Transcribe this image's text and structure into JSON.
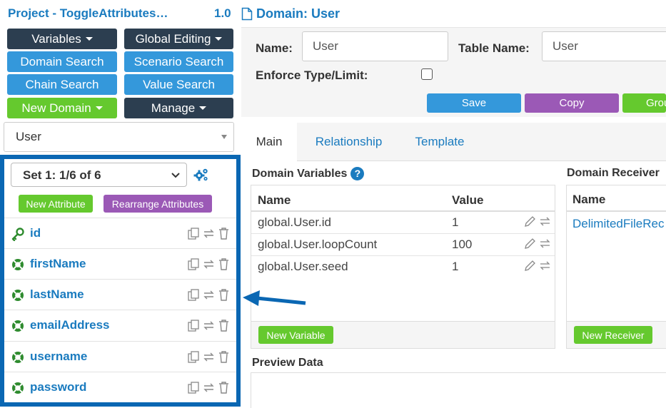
{
  "project": {
    "title": "Project - ToggleAttributes…",
    "version": "1.0"
  },
  "menu": {
    "variables": "Variables",
    "global_editing": "Global Editing",
    "domain_search": "Domain Search",
    "scenario_search": "Scenario Search",
    "chain_search": "Chain Search",
    "value_search": "Value Search",
    "new_domain": "New Domain",
    "manage": "Manage"
  },
  "domain_select": {
    "value": "User"
  },
  "attribute_set": {
    "value": "Set 1: 1/6 of 6"
  },
  "attribute_buttons": {
    "new_attribute": "New Attribute",
    "rearrange": "Rearrange Attributes"
  },
  "attributes": [
    {
      "label": "id",
      "icon": "key-icon"
    },
    {
      "label": "firstName",
      "icon": "lifebuoy-icon"
    },
    {
      "label": "lastName",
      "icon": "lifebuoy-icon"
    },
    {
      "label": "emailAddress",
      "icon": "lifebuoy-icon"
    },
    {
      "label": "username",
      "icon": "lifebuoy-icon"
    },
    {
      "label": "password",
      "icon": "lifebuoy-icon"
    }
  ],
  "domain_header": {
    "title": "Domain: User"
  },
  "form": {
    "name_label": "Name:",
    "name_value": "User",
    "table_name_label": "Table Name:",
    "table_name_value": "User",
    "enforce_label": "Enforce Type/Limit:"
  },
  "actions": {
    "save": "Save",
    "copy": "Copy",
    "group": "Grou"
  },
  "tabs": {
    "main": "Main",
    "relationship": "Relationship",
    "template": "Template"
  },
  "domain_variables": {
    "title": "Domain Variables",
    "col_name": "Name",
    "col_value": "Value",
    "rows": [
      {
        "name": "global.User.id",
        "value": "1"
      },
      {
        "name": "global.User.loopCount",
        "value": "100"
      },
      {
        "name": "global.User.seed",
        "value": "1"
      }
    ],
    "new_button": "New Variable"
  },
  "domain_receivers": {
    "title": "Domain Receiver",
    "col_name": "Name",
    "rows": [
      {
        "name": "DelimitedFileRec"
      }
    ],
    "new_button": "New Receiver"
  },
  "preview": {
    "title": "Preview Data"
  },
  "colors": {
    "primary_blue": "#1a7bbf",
    "dark": "#2c3e50",
    "button_blue": "#3498db",
    "green": "#65c92e",
    "purple": "#9b59b6",
    "highlight": "#0a67b3"
  }
}
